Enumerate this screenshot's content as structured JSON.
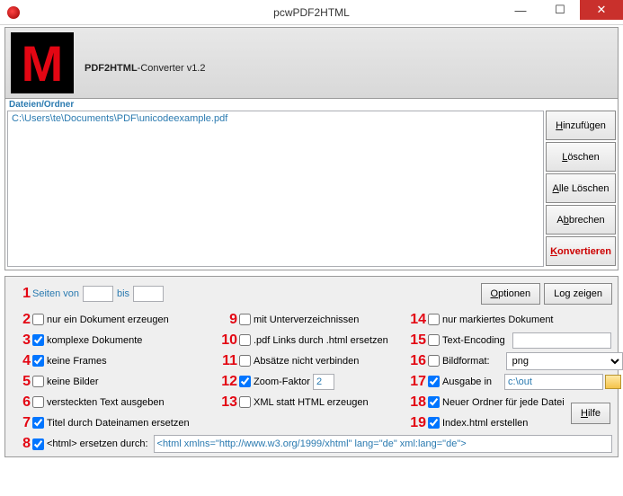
{
  "window": {
    "title": "pcwPDF2HTML"
  },
  "header": {
    "logo": "M",
    "title_bold": "PDF2HTML",
    "title_rest": "-Converter v1.2"
  },
  "files": {
    "label": "Dateien/Ordner",
    "items": [
      "C:\\Users\\te\\Documents\\PDF\\unicodeexample.pdf"
    ],
    "buttons": {
      "add": "Hinzufügen",
      "delete": "Löschen",
      "delete_all": "Alle Löschen",
      "cancel": "Abbrechen",
      "convert": "Konvertieren"
    }
  },
  "opts": {
    "pages_from": "Seiten von",
    "pages_to": "bis",
    "btn_options": "Optionen",
    "btn_log": "Log zeigen",
    "btn_help": "Hilfe",
    "c1": {
      "label": "nur ein Dokument erzeugen",
      "checked": false
    },
    "c2": {
      "label": "komplexe Dokumente",
      "checked": true
    },
    "c3": {
      "label": "keine Frames",
      "checked": true
    },
    "c4": {
      "label": "keine Bilder",
      "checked": false
    },
    "c5": {
      "label": "versteckten Text ausgeben",
      "checked": false
    },
    "c6": {
      "label": "Titel durch Dateinamen ersetzen",
      "checked": true
    },
    "c7": {
      "label": "<html> ersetzen durch:",
      "checked": true
    },
    "c8": {
      "label": "mit Unterverzeichnissen",
      "checked": false
    },
    "c9": {
      "label": ".pdf Links durch .html ersetzen",
      "checked": false
    },
    "c10": {
      "label": "Absätze nicht verbinden",
      "checked": false
    },
    "c11": {
      "label": "Zoom-Faktor",
      "checked": true,
      "value": "2"
    },
    "c12": {
      "label": "XML statt HTML erzeugen",
      "checked": false
    },
    "c13": {
      "label": "nur markiertes Dokument",
      "checked": false
    },
    "c14": {
      "label": "Text-Encoding",
      "checked": false,
      "value": ""
    },
    "c15": {
      "label": "Bildformat:",
      "checked": false,
      "value": "png"
    },
    "c16": {
      "label": "Ausgabe in",
      "checked": true,
      "value": "c:\\out"
    },
    "c17": {
      "label": "Neuer Ordner für jede Datei",
      "checked": true
    },
    "c18": {
      "label": "Index.html erstellen",
      "checked": true
    },
    "html_replace": "<html xmlns=\"http://www.w3.org/1999/xhtml\" lang=\"de\" xml:lang=\"de\">",
    "nums": [
      "1",
      "2",
      "3",
      "4",
      "5",
      "6",
      "7",
      "8",
      "9",
      "10",
      "11",
      "12",
      "13",
      "14",
      "15",
      "16",
      "17",
      "18",
      "19"
    ]
  }
}
